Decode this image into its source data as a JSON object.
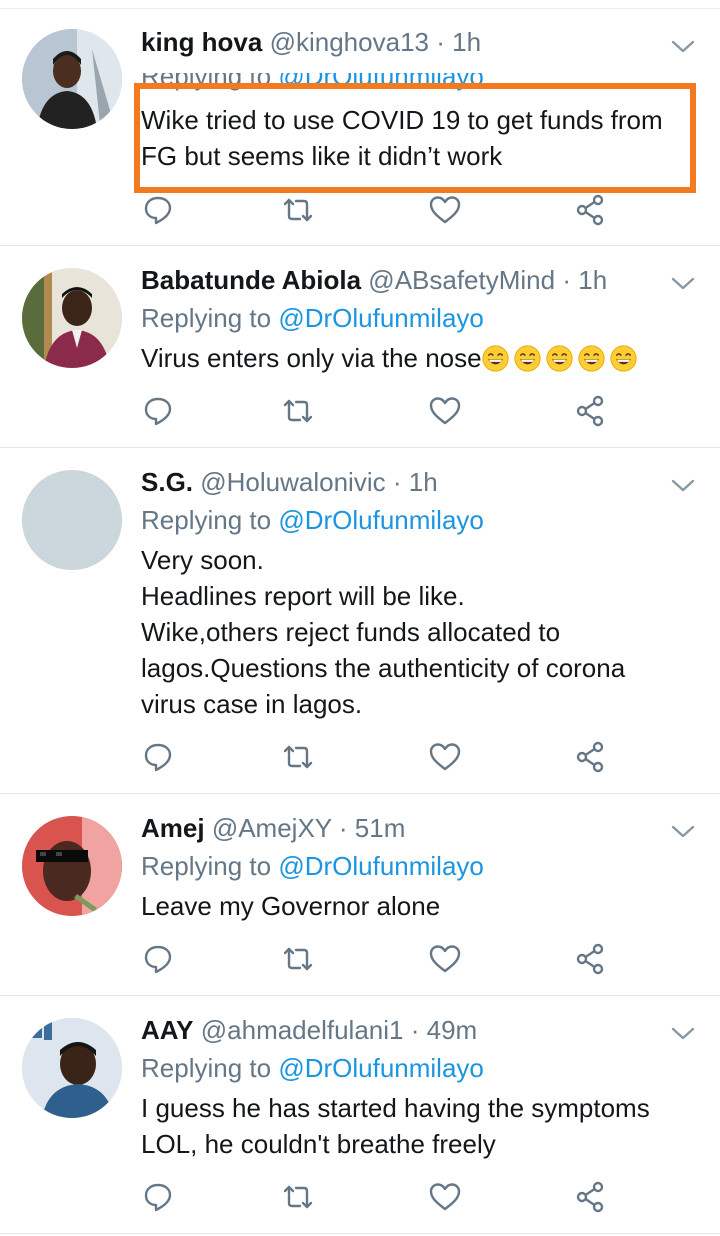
{
  "tweets": [
    {
      "name": "king hova",
      "handle": "@kinghova13",
      "dot": "·",
      "time": "1h",
      "replying_prefix": "Replying to",
      "replying_mention": "@DrOlufunmilayo",
      "lines": [
        "Wike tried to use COVID 19 to get funds from",
        "FG but seems like it didn’t work"
      ]
    },
    {
      "name": "Babatunde Abiola",
      "handle": "@ABsafetyMind",
      "dot": "·",
      "time": "1h",
      "replying_prefix": "Replying to",
      "replying_mention": "@DrOlufunmilayo",
      "lines": [
        "Virus enters only via the nose"
      ],
      "emoji_count": 5
    },
    {
      "name": "S.G.",
      "handle": "@Holuwalonivic",
      "dot": "·",
      "time": "1h",
      "replying_prefix": "Replying to",
      "replying_mention": "@DrOlufunmilayo",
      "lines": [
        "Very soon.",
        "Headlines report will be like.",
        "Wike,others reject funds allocated to",
        "lagos.Questions the authenticity of corona",
        "virus case in lagos."
      ]
    },
    {
      "name": "Amej",
      "handle": "@AmejXY",
      "dot": "·",
      "time": "51m",
      "replying_prefix": "Replying to",
      "replying_mention": "@DrOlufunmilayo",
      "lines": [
        "Leave my Governor alone"
      ]
    },
    {
      "name": "AAY",
      "handle": "@ahmadelfulani1",
      "dot": "·",
      "time": "49m",
      "replying_prefix": "Replying to",
      "replying_mention": "@DrOlufunmilayo",
      "lines": [
        "I guess he has started having the symptoms",
        "LOL, he couldn't breathe freely"
      ]
    }
  ],
  "icons": {
    "reply": "reply-icon",
    "retweet": "retweet-icon",
    "like": "heart-icon",
    "share": "share-icon",
    "menu": "chevron-down-icon"
  },
  "colors": {
    "highlight": "#f47a20",
    "link": "#1b95e0",
    "muted": "#657786",
    "text": "#14171a",
    "divider": "#e1e8ed"
  }
}
